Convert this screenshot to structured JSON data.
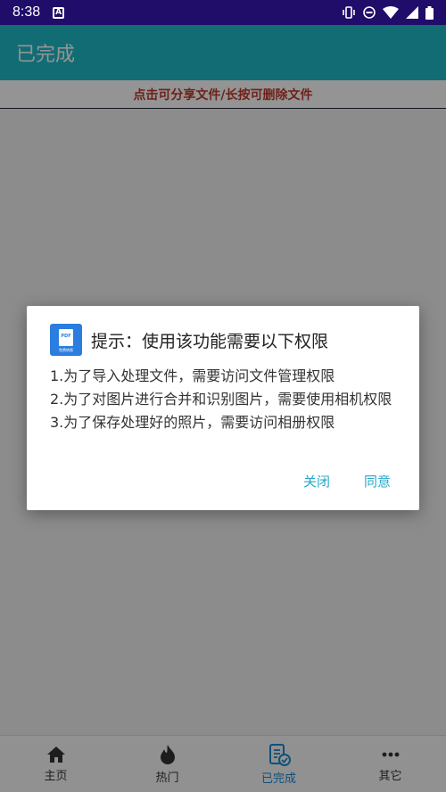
{
  "status_bar": {
    "time": "8:38",
    "notification_glyph": "A"
  },
  "app_bar": {
    "title": "已完成"
  },
  "hint": {
    "text": "点击可分享文件/长按可删除文件"
  },
  "bottom_nav": {
    "items": [
      {
        "label": "主页",
        "icon": "home-icon"
      },
      {
        "label": "热门",
        "icon": "flame-icon"
      },
      {
        "label": "已完成",
        "icon": "checklist-icon",
        "active": true
      },
      {
        "label": "其它",
        "icon": "more-icon"
      }
    ]
  },
  "dialog": {
    "icon_text": "PDF",
    "icon_sub": "免费转换",
    "title": "提示：使用该功能需要以下权限",
    "lines": [
      "1.为了导入处理文件，需要访问文件管理权限",
      "2.为了对图片进行合并和识别图片，需要使用相机权限",
      "3.为了保存处理好的照片，需要访问相册权限"
    ],
    "close_label": "关闭",
    "agree_label": "同意"
  },
  "colors": {
    "app_bar": "#1fbac9",
    "status_bar": "#1f0d69",
    "accent": "#26a8c8",
    "hint": "#c0392b",
    "active_nav": "#1a8ad4"
  }
}
